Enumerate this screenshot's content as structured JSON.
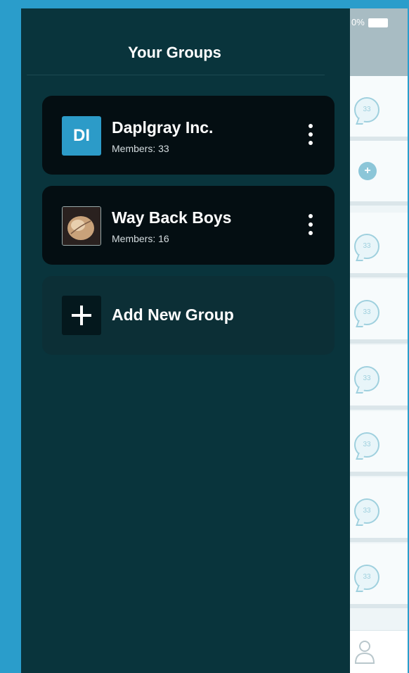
{
  "status_bar": {
    "battery_text": "0%"
  },
  "drawer": {
    "title": "Your Groups",
    "groups": [
      {
        "name": "Daplgray Inc.",
        "members": "Members: 33",
        "avatar_initials": "DI",
        "avatar_color": "#2c9bc8"
      },
      {
        "name": "Way Back Boys",
        "members": "Members: 16",
        "avatar": "photo"
      }
    ],
    "add_group_label": "Add New Group"
  },
  "background_list": {
    "bubble_counts": [
      "33",
      "33",
      "33",
      "33",
      "33",
      "33",
      "33"
    ]
  },
  "colors": {
    "page_bg": "#2a9dcb",
    "drawer_bg": "#09343c",
    "card_bg": "#040e12",
    "add_card_bg": "#0c2f36",
    "accent": "#2c9bc8"
  }
}
